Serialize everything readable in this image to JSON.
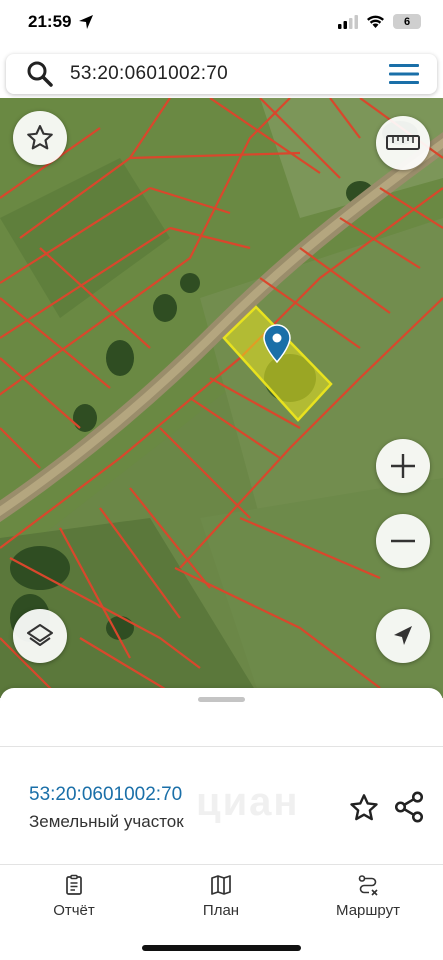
{
  "status_bar": {
    "time": "21:59",
    "battery": "6"
  },
  "search": {
    "query": "53:20:0601002:70"
  },
  "map": {
    "parcel_border_color": "#d9472c",
    "selected_parcel_color": "#e8e21f",
    "marker_color": "#1a6fa8"
  },
  "sheet": {
    "parcel_number": "53:20:0601002:70",
    "parcel_type": "Земельный участок",
    "watermark": "циан"
  },
  "nav": {
    "items": [
      {
        "label": "Отчёт",
        "icon": "report-icon"
      },
      {
        "label": "План",
        "icon": "map-icon"
      },
      {
        "label": "Маршрут",
        "icon": "route-icon"
      }
    ]
  }
}
